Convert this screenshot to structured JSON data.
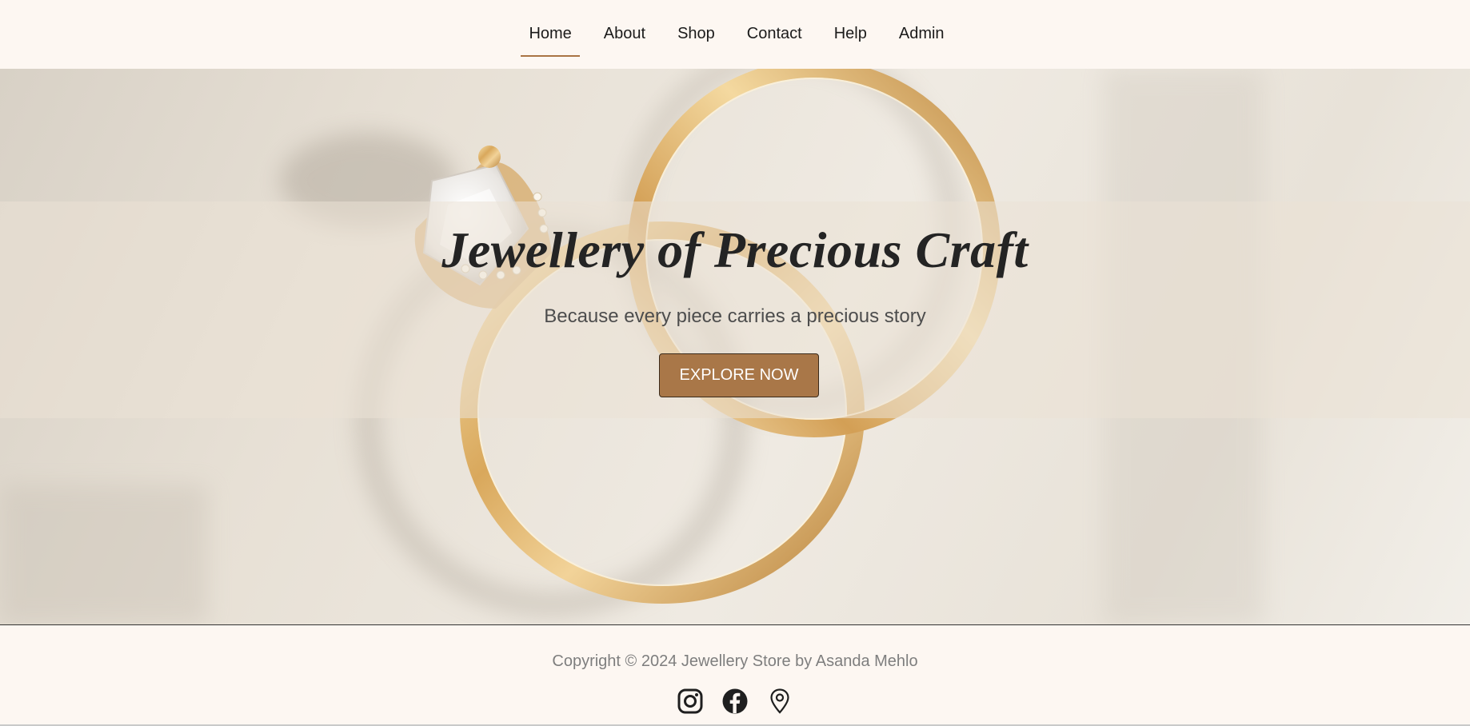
{
  "nav": {
    "items": [
      {
        "label": "Home",
        "active": true
      },
      {
        "label": "About"
      },
      {
        "label": "Shop"
      },
      {
        "label": "Contact"
      },
      {
        "label": "Help"
      },
      {
        "label": "Admin"
      }
    ]
  },
  "hero": {
    "title": "Jewellery of Precious Craft",
    "subtitle": "Because every piece carries a precious story",
    "cta_label": "EXPLORE NOW",
    "image_alt": "Gold engagement ring with diamond and gold band"
  },
  "footer": {
    "copyright": "Copyright © 2024 Jewellery Store by Asanda Mehlo",
    "socials": [
      "instagram-icon",
      "facebook-icon",
      "map-pin-icon"
    ]
  },
  "colors": {
    "background": "#fdf7f2",
    "accent": "#a97748",
    "nav_underline": "#a97444"
  }
}
